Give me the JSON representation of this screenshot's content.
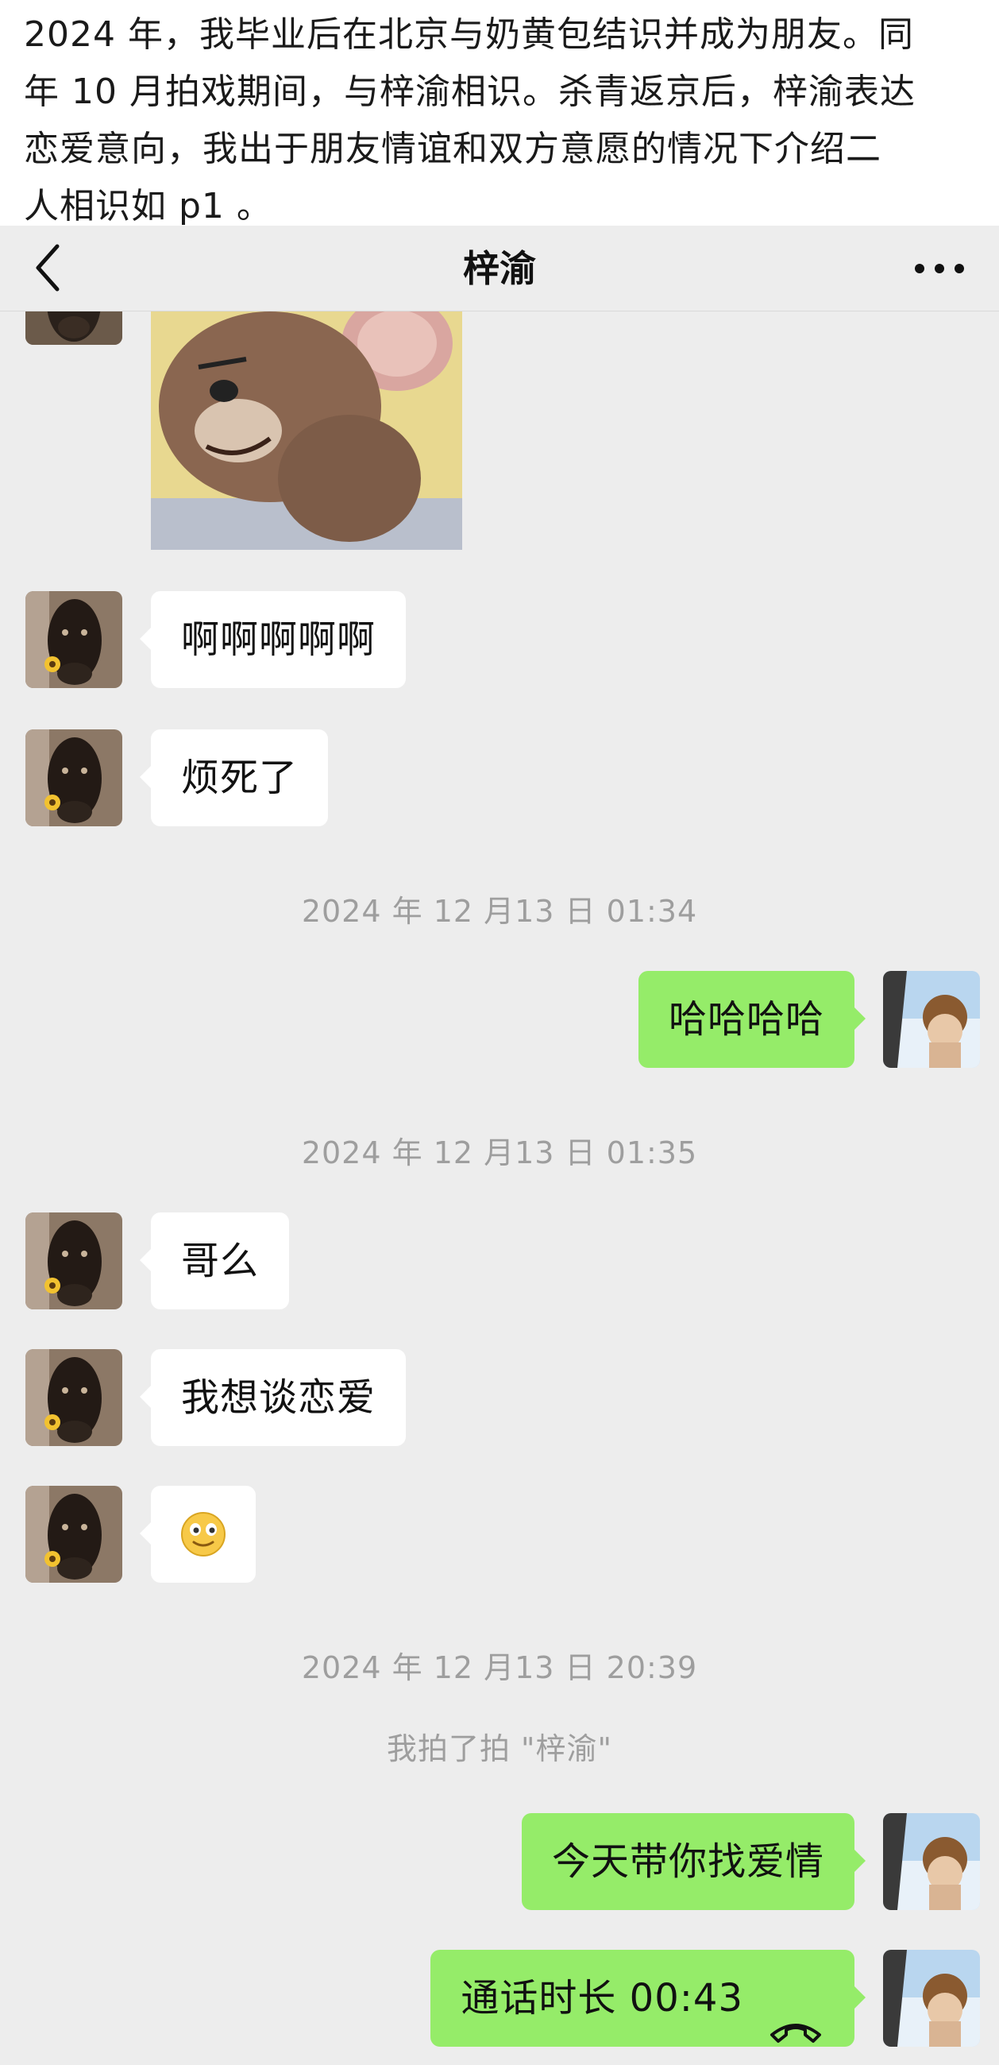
{
  "caption": {
    "lines": [
      "2024 年，我毕业后在北京与奶黄包结识并成为朋友。同",
      "年 10 月拍戏期间，与梓渝相识。杀青返京后，梓渝表达",
      "恋爱意向，我出于朋友情谊和双方意愿的情况下介绍二",
      "人相识如 p1 。"
    ]
  },
  "nav": {
    "title": "梓渝",
    "back_icon": "chevron-left-icon",
    "more_icon": "more-dots-icon"
  },
  "messages": {
    "m1": "啊啊啊啊啊",
    "m2": "烦死了",
    "ts1": "2024 年 12 月13 日 01:34",
    "m3": "哈哈哈哈",
    "ts2": "2024 年 12 月13 日 01:35",
    "m4": "哥么",
    "m5": "我想谈恋爱",
    "m6_icon": "smiling-emoji-icon",
    "ts3": "2024 年 12 月13 日 20:39",
    "pat": "我拍了拍 \"梓渝\"",
    "m7": "今天带你找爱情",
    "m8": "通话时长 00:43",
    "m8_icon": "phone-hangup-icon"
  },
  "colors": {
    "bubble_out": "#95ec69",
    "bubble_in": "#ffffff",
    "chat_bg": "#ededed",
    "timestamp": "#9e9e9e"
  }
}
